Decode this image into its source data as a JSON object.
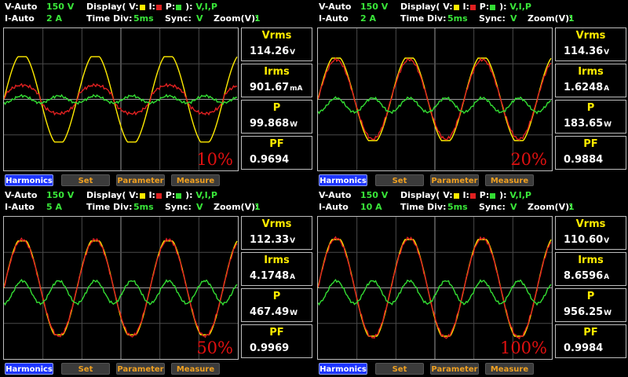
{
  "labels": {
    "v_range": "V-Auto",
    "i_range": "I-Auto",
    "display": "Display( V:",
    "display_i": " I:",
    "display_p": " P:",
    "display_close": " ):",
    "time_div": "Time Div:",
    "sync": "Sync:",
    "zoom": "Zoom(V):",
    "vrms": "Vrms",
    "irms": "Irms",
    "p": "P",
    "pf": "PF"
  },
  "colors": {
    "voltage": "#ffeb00",
    "current": "#e02020",
    "power": "#33dd33"
  },
  "softkeys": [
    "Harmonics",
    "Set",
    "Parameter",
    "Measure"
  ],
  "panels": [
    {
      "v_range": "150 V",
      "i_range": "2 A",
      "display_sel": "V,I,P",
      "time_div": "5ms",
      "sync": "V",
      "zoom": "1",
      "vrms": "114.26",
      "vrms_unit": "V",
      "irms": "901.67",
      "irms_unit": "mA",
      "p": "99.868",
      "p_unit": "W",
      "pf": "0.9694",
      "load": "10%",
      "trace": {
        "v_amp": 0.6,
        "i_amp": 0.2,
        "p_amp": 0.1,
        "p_off": 0.05,
        "shape": "light"
      }
    },
    {
      "v_range": "150 V",
      "i_range": "2 A",
      "display_sel": "V,I,P",
      "time_div": "5ms",
      "sync": "V",
      "zoom": "1",
      "vrms": "114.36",
      "vrms_unit": "V",
      "irms": "1.6248",
      "irms_unit": "A",
      "p": "183.65",
      "p_unit": "W",
      "pf": "0.9884",
      "load": "20%",
      "trace": {
        "v_amp": 0.58,
        "i_amp": 0.56,
        "p_amp": 0.2,
        "p_off": 0.18,
        "shape": "mid"
      }
    },
    {
      "v_range": "150 V",
      "i_range": "5 A",
      "display_sel": "V,I,P",
      "time_div": "5ms",
      "sync": "V",
      "zoom": "1",
      "vrms": "112.33",
      "vrms_unit": "V",
      "irms": "4.1748",
      "irms_unit": "A",
      "p": "467.49",
      "p_unit": "W",
      "pf": "0.9969",
      "load": "50%",
      "trace": {
        "v_amp": 0.66,
        "i_amp": 0.68,
        "p_amp": 0.32,
        "p_off": 0.22,
        "shape": "heavy"
      }
    },
    {
      "v_range": "150 V",
      "i_range": "10 A",
      "display_sel": "V,I,P",
      "time_div": "5ms",
      "sync": "V",
      "zoom": "1",
      "vrms": "110.60",
      "vrms_unit": "V",
      "irms": "8.6596",
      "irms_unit": "A",
      "p": "956.25",
      "p_unit": "W",
      "pf": "0.9984",
      "load": "100%",
      "trace": {
        "v_amp": 0.68,
        "i_amp": 0.7,
        "p_amp": 0.32,
        "p_off": 0.22,
        "shape": "heavy"
      }
    }
  ]
}
